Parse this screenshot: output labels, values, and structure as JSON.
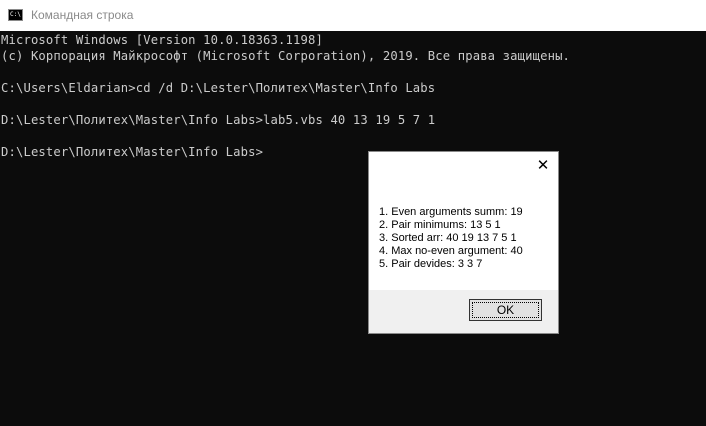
{
  "window": {
    "title": "Командная строка",
    "icon": "console-app-icon",
    "icon_text": "C:\\."
  },
  "console": {
    "lines": [
      "Microsoft Windows [Version 10.0.18363.1198]",
      "(c) Корпорация Майкрософт (Microsoft Corporation), 2019. Все права защищены.",
      "",
      "C:\\Users\\Eldarian>cd /d D:\\Lester\\Политех\\Master\\Info Labs",
      "",
      "D:\\Lester\\Политех\\Master\\Info Labs>lab5.vbs 40 13 19 5 7 1",
      "",
      "D:\\Lester\\Политех\\Master\\Info Labs>"
    ],
    "colors": {
      "background": "#0c0c0c",
      "text": "#cccccc"
    }
  },
  "message_box": {
    "close_glyph": "✕",
    "lines": [
      "1. Even arguments summ: 19",
      "2. Pair minimums: 13 5 1",
      "3. Sorted arr: 40 19 13 7 5 1",
      "4. Max no-even argument: 40",
      "5. Pair devides: 3 3 7"
    ],
    "ok_label": "OK"
  }
}
